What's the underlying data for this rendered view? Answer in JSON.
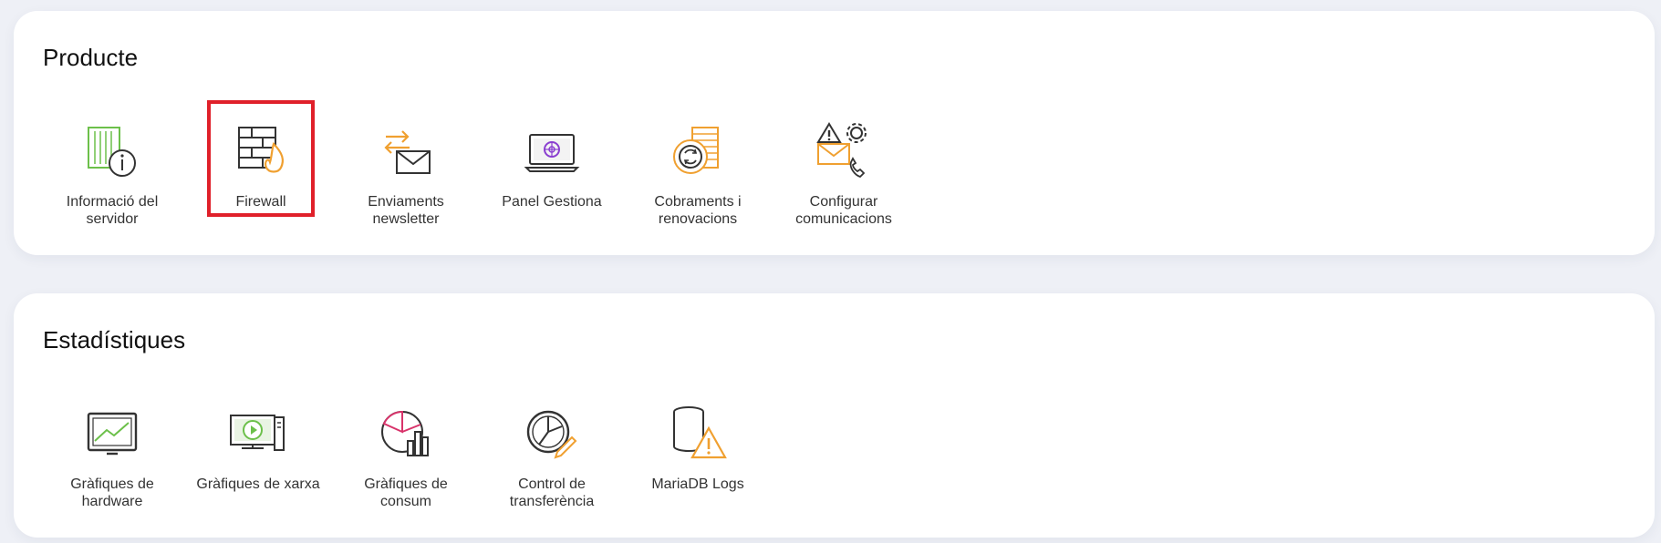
{
  "sections": [
    {
      "title": "Producte",
      "items": [
        {
          "label": "Informació del servidor",
          "icon": "server-info-icon"
        },
        {
          "label": "Firewall",
          "icon": "firewall-icon"
        },
        {
          "label": "Enviaments newsletter",
          "icon": "newsletter-icon"
        },
        {
          "label": "Panel Gestiona",
          "icon": "panel-gestiona-icon"
        },
        {
          "label": "Cobraments i renovacions",
          "icon": "payments-renewals-icon"
        },
        {
          "label": "Configurar comunicacions",
          "icon": "configure-communications-icon"
        }
      ]
    },
    {
      "title": "Estadístiques",
      "items": [
        {
          "label": "Gràfiques de hardware",
          "icon": "hardware-chart-icon"
        },
        {
          "label": "Gràfiques de xarxa",
          "icon": "network-chart-icon"
        },
        {
          "label": "Gràfiques de consum",
          "icon": "consumption-chart-icon"
        },
        {
          "label": "Control de transferència",
          "icon": "transfer-control-icon"
        },
        {
          "label": "MariaDB Logs",
          "icon": "mariadb-logs-icon"
        }
      ]
    }
  ],
  "colors": {
    "highlight": "#e0202a",
    "green": "#6cc04a",
    "orange": "#f0a030",
    "purple": "#8a3fd0",
    "pink": "#d8336a",
    "dark": "#333333"
  }
}
